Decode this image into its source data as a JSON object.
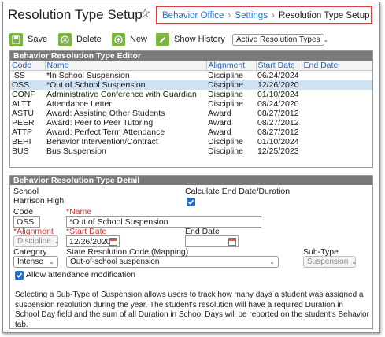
{
  "header": {
    "title": "Resolution Type Setup",
    "breadcrumb": [
      "Behavior Office",
      "Settings",
      "Resolution Type Setup"
    ]
  },
  "toolbar": {
    "save_label": "Save",
    "delete_label": "Delete",
    "new_label": "New",
    "history_label": "Show History",
    "filter_value": "Active Resolution Types"
  },
  "editor": {
    "title": "Behavior Resolution Type Editor",
    "columns": [
      "Code",
      "Name",
      "Alignment",
      "Start Date",
      "End Date"
    ],
    "rows": [
      [
        "ISS",
        "*In School Suspension",
        "Discipline",
        "06/24/2024",
        ""
      ],
      [
        "OSS",
        "*Out of School Suspension",
        "Discipline",
        "12/26/2020",
        ""
      ],
      [
        "CONF",
        "Administrative Conference with Guardian",
        "Discipline",
        "01/10/2024",
        ""
      ],
      [
        "ALTT",
        "Attendance Letter",
        "Discipline",
        "08/24/2020",
        ""
      ],
      [
        "ASTU",
        "Award: Assisting Other Students",
        "Award",
        "08/27/2012",
        ""
      ],
      [
        "PEER",
        "Award: Peer to Peer Tutoring",
        "Award",
        "08/27/2012",
        ""
      ],
      [
        "ATTP",
        "Award: Perfect Term Attendance",
        "Award",
        "08/27/2012",
        ""
      ],
      [
        "BEHI",
        "Behavior Intervention/Contract",
        "Discipline",
        "01/10/2024",
        ""
      ],
      [
        "BUS",
        "Bus Suspension",
        "Discipline",
        "12/25/2023",
        ""
      ]
    ],
    "selected_index": 1
  },
  "detail": {
    "title": "Behavior Resolution Type Detail",
    "school_label": "School",
    "school_value": "Harrison High",
    "calc_label": "Calculate End Date/Duration",
    "code_label": "Code",
    "code_value": "OSS",
    "name_label": "*Name",
    "name_value": "*Out of School Suspension",
    "alignment_label": "*Alignment",
    "alignment_value": "Discipline",
    "start_label": "*Start Date",
    "start_value": "12/26/2020",
    "end_label": "End Date",
    "end_value": "",
    "category_label": "Category",
    "category_value": "Intense",
    "state_label": "State Resolution Code (Mapping)",
    "state_value": "Out-of-school suspension",
    "subtype_label": "Sub-Type",
    "subtype_value": "Suspension",
    "allow_label": "Allow attendance modification",
    "description": "Selecting a Sub-Type of Suspension allows users to track how many days a student was assigned a suspension resolution during the year. The student's resolution will have a required Duration in School Day field and the sum of all Duration in School Days will be reported on the student's Behavior tab."
  },
  "colors": {
    "accent": "#1a73c8",
    "highlight_border": "#e03c3c",
    "header_bar": "#7a7a7a",
    "selected_row": "#cfe2f3",
    "button_green": "#7cb342"
  }
}
